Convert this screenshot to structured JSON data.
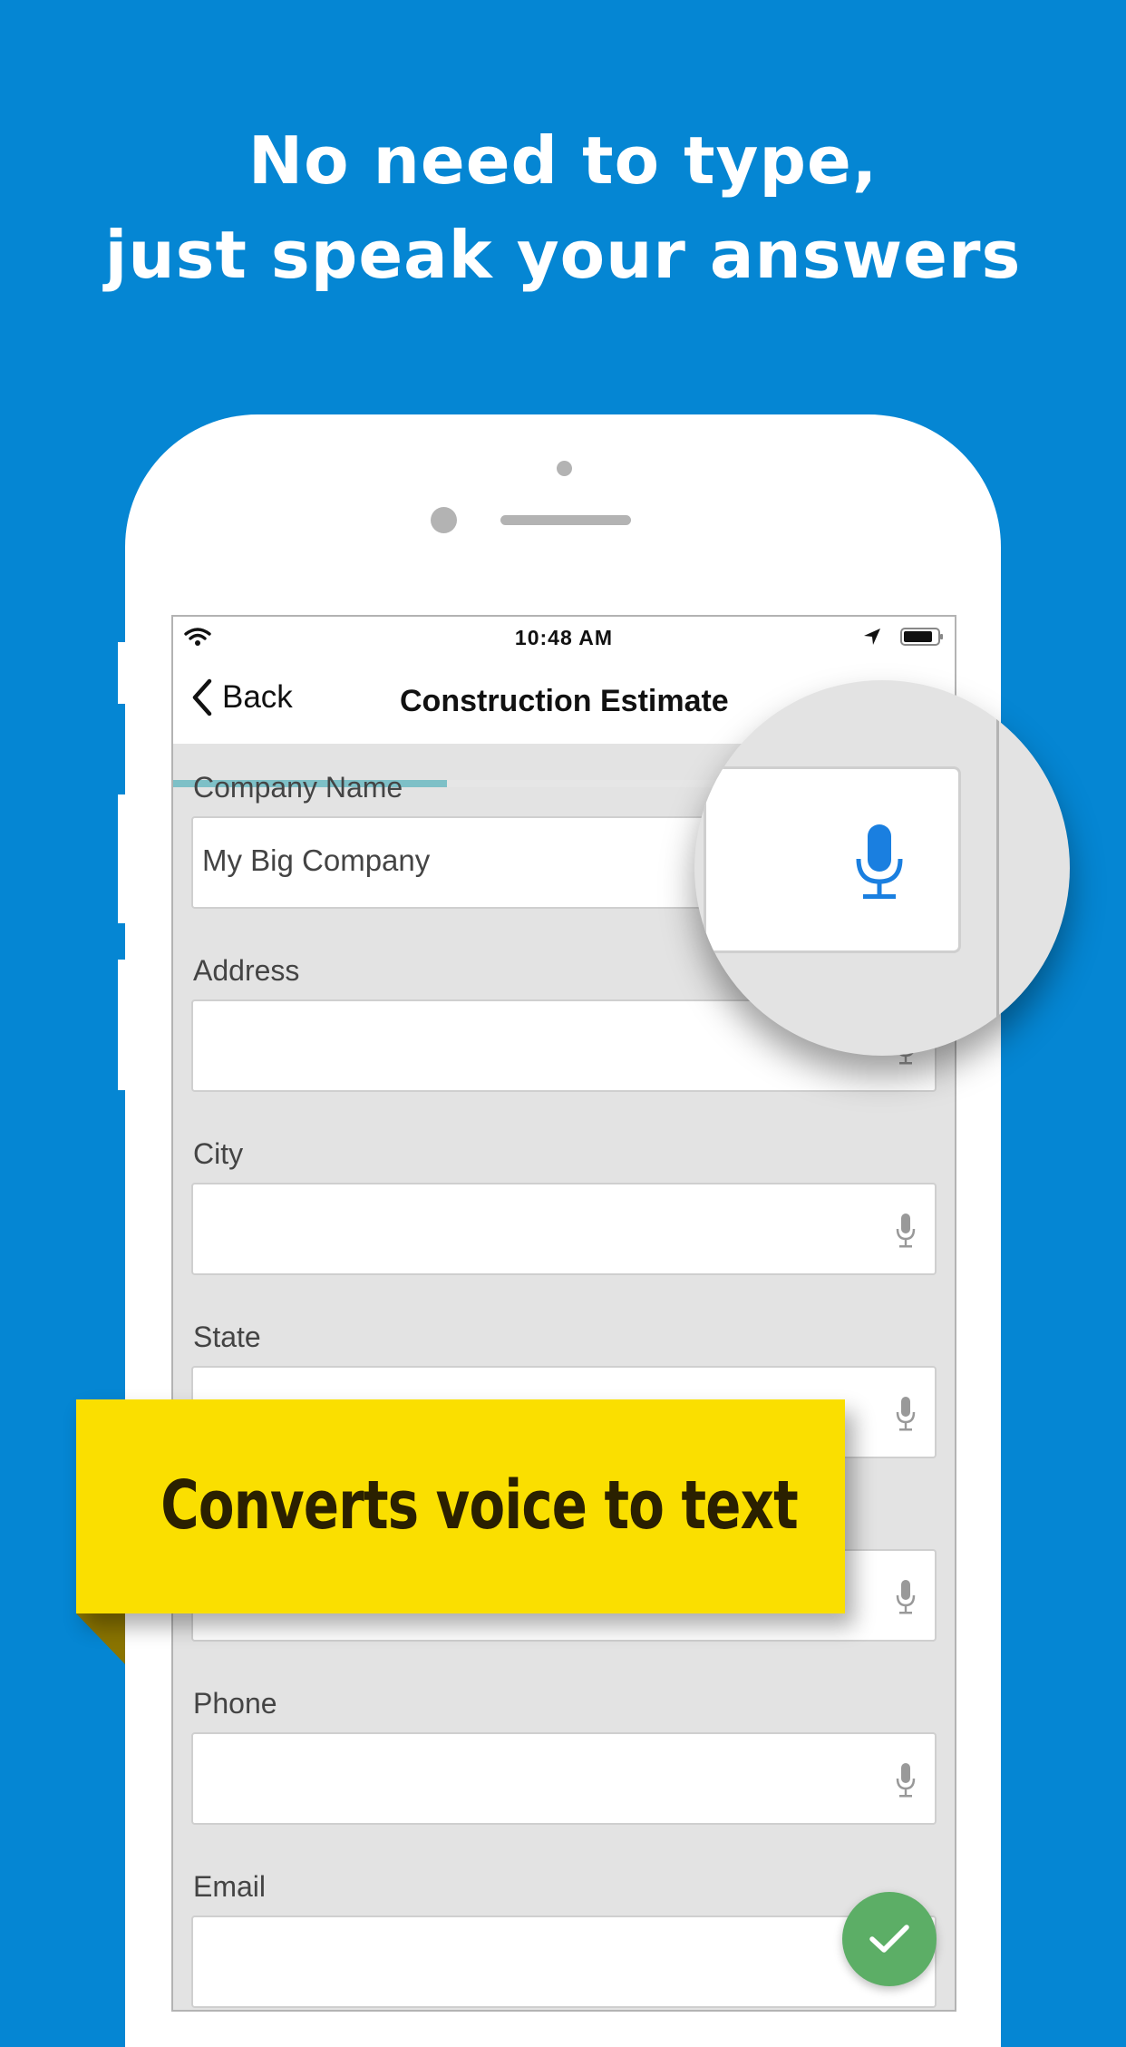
{
  "headline": {
    "line1": "No need to type,",
    "line2": "just speak your answers"
  },
  "status_bar": {
    "time": "10:48 AM",
    "icons": [
      "wifi-icon",
      "location-arrow-icon",
      "battery-icon"
    ]
  },
  "nav": {
    "back_label": "Back",
    "title": "Construction Estimate",
    "progress_fraction": 0.35
  },
  "form": {
    "fields": [
      {
        "label": "Company Name",
        "value": "My Big Company"
      },
      {
        "label": "Address",
        "value": ""
      },
      {
        "label": "City",
        "value": ""
      },
      {
        "label": "State",
        "value": ""
      },
      {
        "label": "",
        "value": ""
      },
      {
        "label": "Phone",
        "value": ""
      },
      {
        "label": "Email",
        "value": ""
      }
    ]
  },
  "banner": {
    "text": "Converts voice to text"
  },
  "colors": {
    "background": "#0586d3",
    "banner": "#fadf00",
    "fab": "#5cae66",
    "mic_active": "#1a7fe0",
    "progress": "#7ec0c7"
  }
}
